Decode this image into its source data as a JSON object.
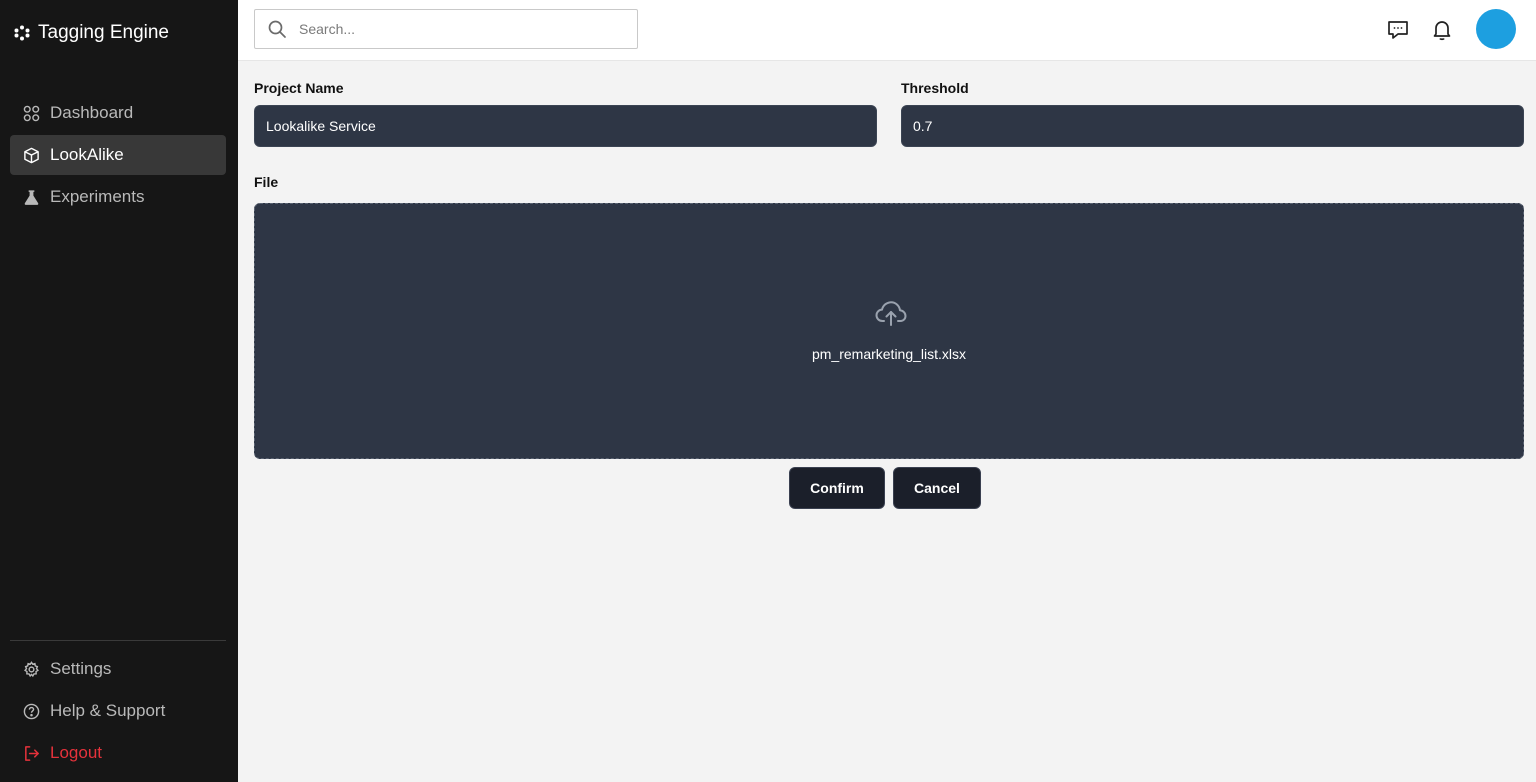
{
  "app": {
    "title": "Tagging Engine"
  },
  "sidebar": {
    "items": [
      {
        "label": "Dashboard",
        "icon": "grid-icon",
        "active": false
      },
      {
        "label": "LookAlike",
        "icon": "cube-icon",
        "active": true
      },
      {
        "label": "Experiments",
        "icon": "flask-icon",
        "active": false
      }
    ],
    "bottom_items": [
      {
        "label": "Settings",
        "icon": "gear-icon"
      },
      {
        "label": "Help & Support",
        "icon": "help-circle-icon"
      },
      {
        "label": "Logout",
        "icon": "logout-icon"
      }
    ]
  },
  "header": {
    "search": {
      "placeholder": "Search...",
      "value": ""
    },
    "icons": [
      "message-icon",
      "bell-icon"
    ],
    "avatar_color": "#1d9fe0"
  },
  "form": {
    "project_name": {
      "label": "Project Name",
      "value": "Lookalike Service"
    },
    "threshold": {
      "label": "Threshold",
      "value": "0.7"
    },
    "file": {
      "label": "File",
      "filename": "pm_remarketing_list.xlsx",
      "icon": "cloud-upload-icon"
    }
  },
  "actions": {
    "confirm_label": "Confirm",
    "cancel_label": "Cancel"
  },
  "colors": {
    "sidebar_bg": "#161616",
    "field_bg": "#2e3645",
    "button_bg": "#1b1f2a",
    "logout": "#e5323b",
    "accent": "#1d9fe0"
  }
}
